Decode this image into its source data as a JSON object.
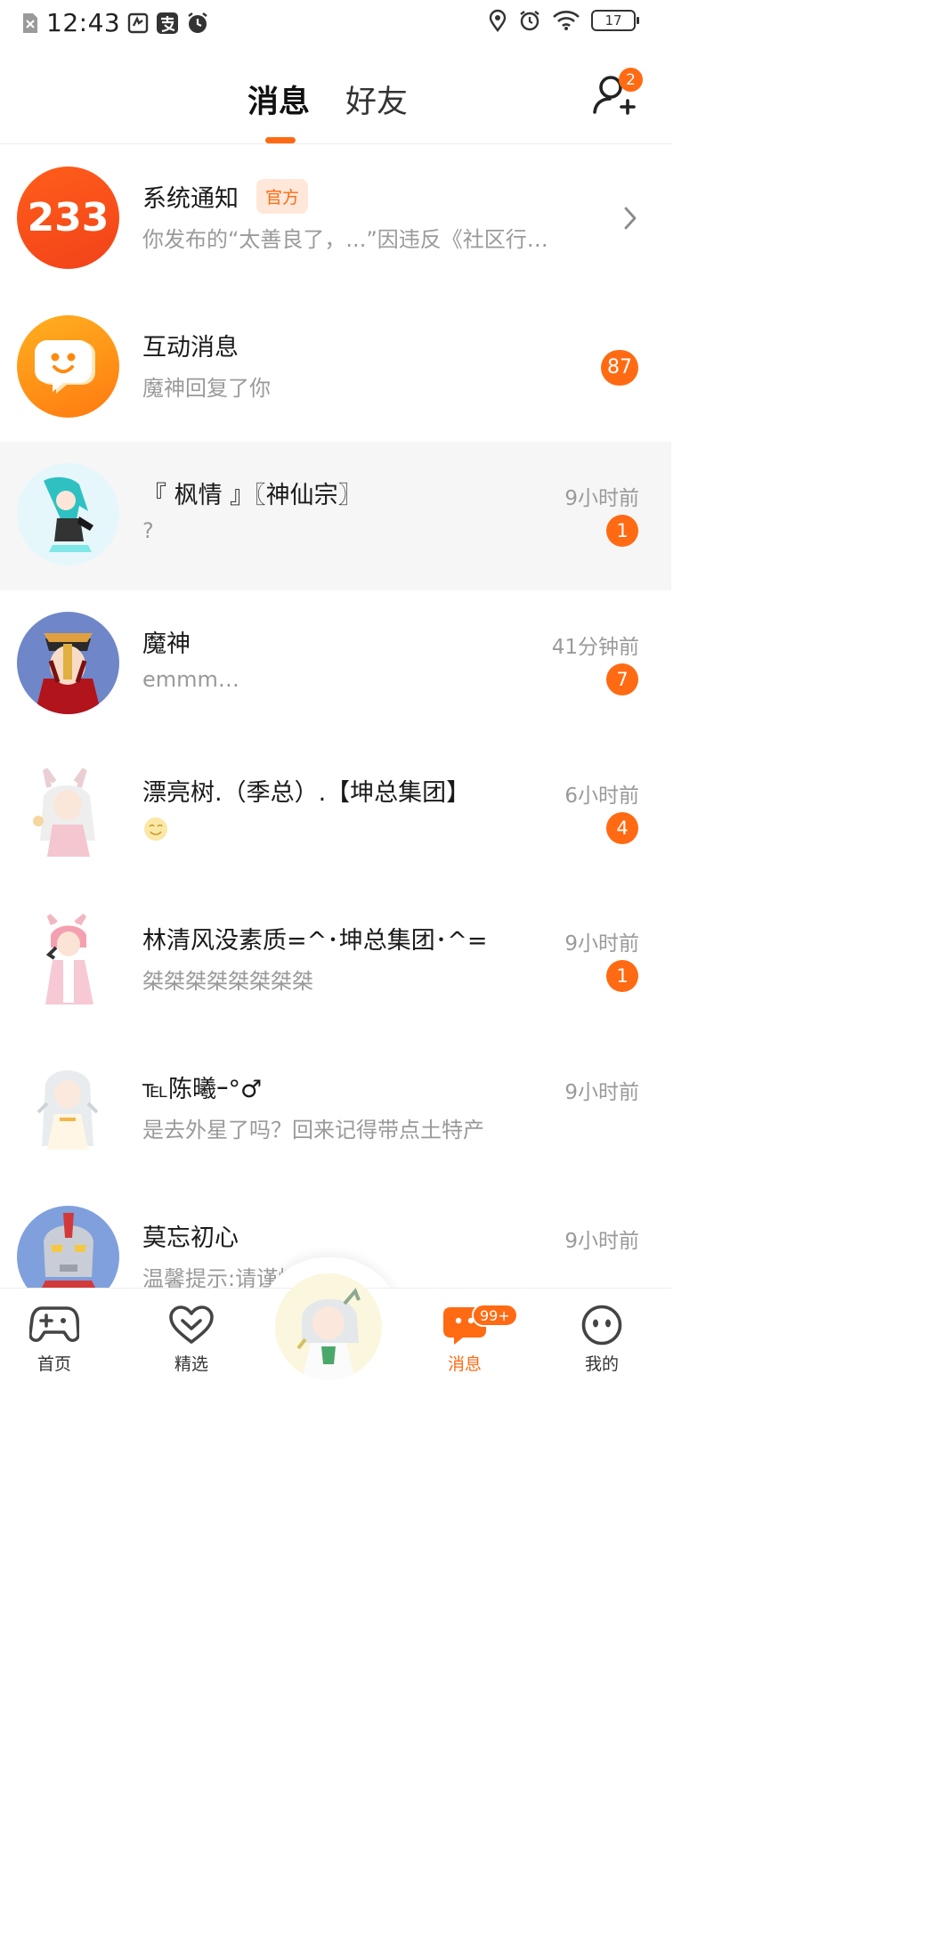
{
  "status_bar": {
    "time": "12:43",
    "battery": "17",
    "left_icons": [
      "no-sim-icon",
      "app-notification-icon",
      "alipay-icon",
      "alarm-icon"
    ],
    "right_icons": [
      "location-icon",
      "alarm-icon",
      "wifi-icon",
      "battery-icon"
    ]
  },
  "header": {
    "tabs": [
      {
        "label": "消息",
        "active": true
      },
      {
        "label": "好友",
        "active": false
      }
    ],
    "add_friend_badge": "2",
    "accent_color": "#ff6a12"
  },
  "messages": [
    {
      "name": "系统通知",
      "tag": "官方",
      "preview": "你发布的“太善良了，...”因违反《社区行…",
      "avatar": "system-233-avatar",
      "has_arrow": true
    },
    {
      "name": "互动消息",
      "preview": "魔神回复了你",
      "badge": "87",
      "avatar": "interaction-avatar"
    },
    {
      "name": "『 枫情 』〖神仙宗〗",
      "preview": "?",
      "time": "9小时前",
      "badge": "1",
      "avatar": "user-avatar"
    },
    {
      "name": "魔神",
      "preview": "emmm…",
      "time": "41分钟前",
      "badge": "7",
      "avatar": "user-avatar"
    },
    {
      "name": "漂亮树.（季总）.【坤总集团】",
      "preview": "",
      "preview_emoji": "smile-emoji",
      "time": "6小时前",
      "badge": "4",
      "avatar": "user-avatar"
    },
    {
      "name": "林清风没素质=^･坤总集团･^=",
      "preview": "桀桀桀桀桀桀桀桀",
      "time": "9小时前",
      "badge": "1",
      "avatar": "user-avatar"
    },
    {
      "name": "℡陈曦ｰ°♂",
      "preview": "是去外星了吗？回来记得带点土特产",
      "time": "9小时前",
      "avatar": "user-avatar"
    },
    {
      "name": "莫忘初心",
      "preview": "温馨提示:请谨慎",
      "time": "9小时前",
      "avatar": "user-avatar"
    }
  ],
  "bottom_nav": {
    "items": [
      {
        "label": "首页",
        "icon": "gamepad-icon"
      },
      {
        "label": "精选",
        "icon": "heart-icon"
      },
      {
        "label": "消息",
        "icon": "chat-icon",
        "active": true,
        "badge": "99+"
      },
      {
        "label": "我的",
        "icon": "face-icon"
      }
    ],
    "center_icon": "anime-avatar-icon"
  }
}
